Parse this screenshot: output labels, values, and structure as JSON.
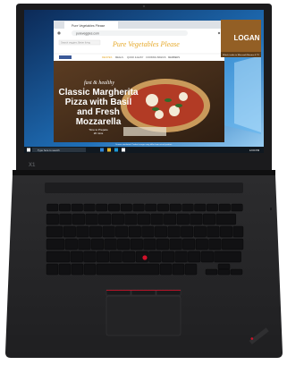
{
  "browser": {
    "tab_title": "Pure Vegetables Please",
    "address": "pureveggies.com",
    "search_placeholder": "Search veggies, Better living",
    "site_name": "Pure Vegetables Please",
    "nav_items": [
      "RECIPES",
      "MEALS",
      "QUICK & EASY",
      "COOKING BASICS",
      "MEMBERS"
    ]
  },
  "hero": {
    "kicker": "fast & healthy",
    "headline_lines": [
      "Classic Margherita",
      "Pizza with Basil",
      "and Fresh",
      "Mozzarella"
    ],
    "byline": "Time to Prepare",
    "byline_time": "20 mins"
  },
  "side_video": {
    "title": "LOGAN",
    "caption": "Watch trailer in Microsoft Movies & TV"
  },
  "taskbar": {
    "search_placeholder": "Type here to search",
    "time": "12:00 PM"
  },
  "screen_disclaimer": "Screen simulated. Product images may differ from actual product.",
  "laptop_logo": "X1",
  "colors": {
    "lid": "#1b1b1d",
    "deck": "#272729",
    "key": "#111113",
    "trackpoint": "#d2112a",
    "desktop_blue": "#1f6fb8",
    "site_accent": "#e6a92a"
  }
}
